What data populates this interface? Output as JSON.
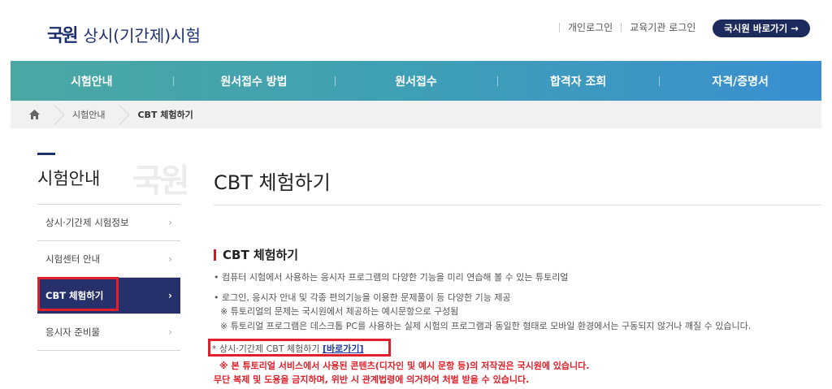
{
  "header": {
    "logo_mark": "국원",
    "logo_text": "상시(기간제)시험",
    "links": [
      "개인로그인",
      "교육기관 로그인"
    ],
    "go_button": "국시원 바로가기 →"
  },
  "nav": {
    "items": [
      "시험안내",
      "원서접수 방법",
      "원서접수",
      "합격자 조회",
      "자격/증명서"
    ]
  },
  "breadcrumb": {
    "home_icon": "home-icon",
    "items": [
      "시험안내",
      "CBT 체험하기"
    ]
  },
  "sidebar": {
    "title": "시험안내",
    "watermark": "국원",
    "items": [
      {
        "label": "상시·기간제 시험정보",
        "active": false
      },
      {
        "label": "시험센터 안내",
        "active": false
      },
      {
        "label": "CBT 체험하기",
        "active": true
      },
      {
        "label": "응시자 준비물",
        "active": false
      }
    ]
  },
  "main": {
    "page_title": "CBT 체험하기",
    "section_title": "CBT 체험하기",
    "bullets": [
      "• 컴퓨터 시험에서 사용하는 응시자 프로그램의 다양한 기능을 미리 연습해 볼 수 있는 튜토리얼",
      "• 로그인, 응시자 안내 및 각종 편의기능을 이용한 문제풀이 등 다양한 기능 제공"
    ],
    "notes": [
      "※ 튜토리얼의 문제는 국시원에서 제공하는 예시문항으로 구성됨",
      "※ 튜토리얼 프로그램은 데스크톱 PC를 사용하는 실제 시험의 프로그램과 동일한 형태로 모바일 환경에서는 구동되지 않거나 깨질 수 있습니다."
    ],
    "link_prefix": "* 상시·기간제 CBT 체험하기 ",
    "link_label": "[바로가기]",
    "warnings": [
      "※ 본 튜토리얼 서비스에서 사용된 콘텐츠(디자인 및 예시 문항 등)의 저작권은 국시원에 있습니다.",
      "무단 복제 및 도용을 금지하며, 위반 시 관계법령에 의거하여 처벌 받을 수 있습니다."
    ]
  },
  "colors": {
    "brand_navy": "#1d2f6f",
    "active_menu": "#26306b",
    "highlight_red": "#e0202a",
    "nav_gradient_start": "#4aa8a3",
    "nav_gradient_end": "#3a8fd0"
  }
}
